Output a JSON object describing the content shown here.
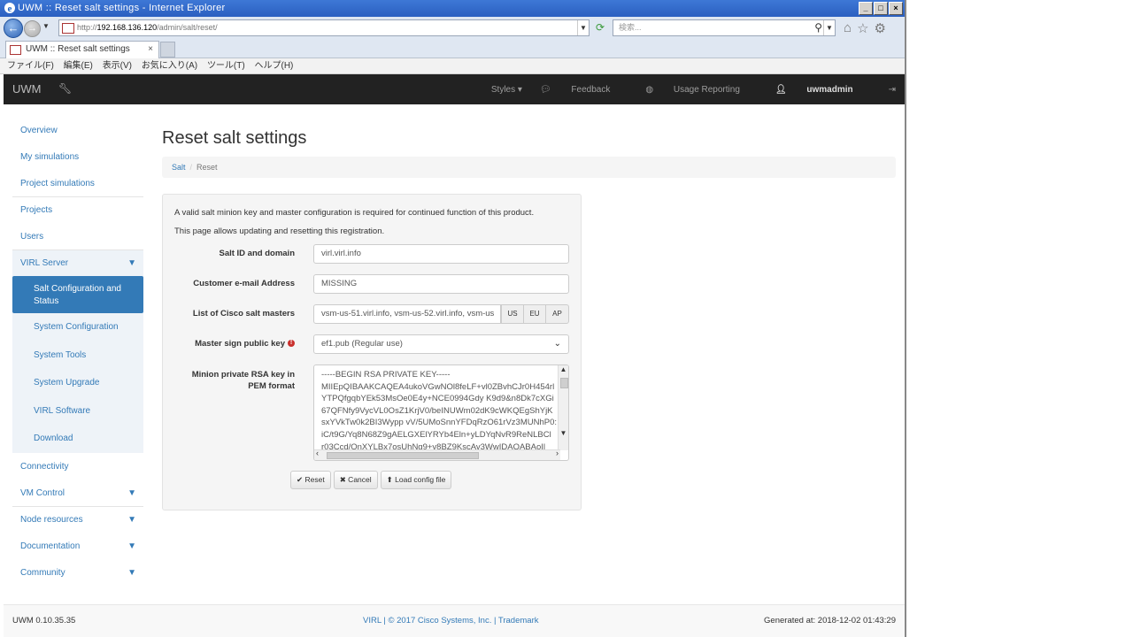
{
  "window": {
    "title": "UWM :: Reset salt settings - Internet Explorer",
    "min": "_",
    "max": "□",
    "close": "×"
  },
  "addressbar": {
    "url_prefix": "http://",
    "url_host": "192.168.136.120",
    "url_path": "/admin/salt/reset/",
    "search_placeholder": "検索..."
  },
  "tab": {
    "label": "UWM :: Reset salt settings",
    "close": "×"
  },
  "menubar": [
    "ファイル(F)",
    "編集(E)",
    "表示(V)",
    "お気に入り(A)",
    "ツール(T)",
    "ヘルプ(H)"
  ],
  "navbar": {
    "brand": "UWM",
    "styles": "Styles ▾",
    "feedback": "Feedback",
    "usage": "Usage Reporting",
    "user": "uwmadmin"
  },
  "sidebar": {
    "overview": "Overview",
    "my_simulations": "My simulations",
    "project_simulations": "Project simulations",
    "projects": "Projects",
    "users": "Users",
    "virl_server": "VIRL Server",
    "salt_config": "Salt Configuration and Status",
    "system_config": "System Configuration",
    "system_tools": "System Tools",
    "system_upgrade": "System Upgrade",
    "virl_software": "VIRL Software",
    "download": "Download",
    "connectivity": "Connectivity",
    "vm_control": "VM Control",
    "node_resources": "Node resources",
    "documentation": "Documentation",
    "community": "Community"
  },
  "main": {
    "title": "Reset salt settings",
    "breadcrumb": [
      "Salt",
      "Reset"
    ],
    "intro1": "A valid salt minion key and master configuration is required for continued function of this product.",
    "intro2": "This page allows updating and resetting this registration.",
    "fields": {
      "salt_id_label": "Salt ID and domain",
      "salt_id_value": "virl.virl.info",
      "email_label": "Customer e-mail Address",
      "email_value": "MISSING",
      "masters_label": "List of Cisco salt masters",
      "masters_value": "vsm-us-51.virl.info, vsm-us-52.virl.info, vsm-us",
      "masters_us": "US",
      "masters_eu": "EU",
      "masters_ap": "AP",
      "sign_key_label": "Master sign public key",
      "sign_key_value": "ef1.pub (Regular use)",
      "rsa_label_1": "Minion private RSA key in",
      "rsa_label_2": "PEM format",
      "rsa_value": "-----BEGIN RSA PRIVATE KEY-----\nMIIEpQIBAAKCAQEA4ukoVGwNOl8feLF+vl0ZBvhCJr0H454rl\nYTPQfgqbYEk53MsOe0E4y+NCE0994Gdy K9d9&n8Dk7cXGi\n67QFNfy9VycVL0OsZ1KrjV0/beINUWm02dK9cWKQEgShYjK\nsxYVkTw0k2BI3Wypp vV/5UMoSnnYFDqRzO61rVz3MUNhP0:\niC/t9G/Yq8N68Z9gAELGXElYRYb4Eln+yLDYqNvR9ReNLBCl\nr03Ccd/OnXYLBx7osUhNq9+v8BZ9KscAv3WwIDAQABAoIl"
    },
    "buttons": {
      "reset": "✔ Reset",
      "cancel": "✖ Cancel",
      "load": "⬆ Load config file"
    }
  },
  "footer": {
    "version": "UWM 0.10.35.35",
    "center": "VIRL | © 2017 Cisco Systems, Inc. | Trademark",
    "generated": "Generated at: 2018-12-02 01:43:29"
  }
}
